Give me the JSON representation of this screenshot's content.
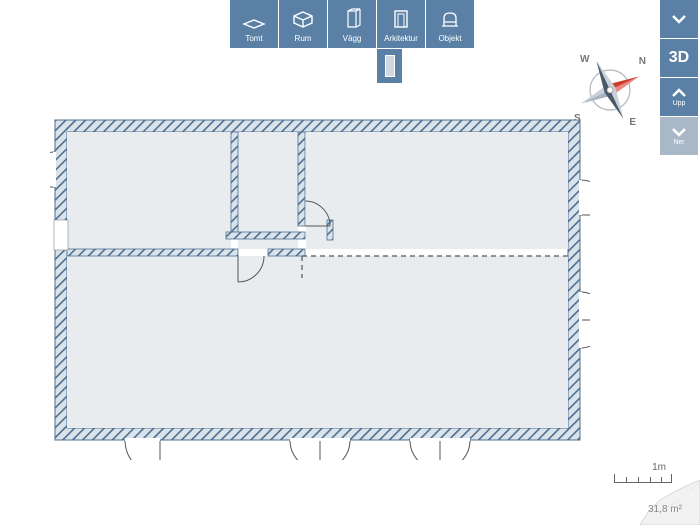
{
  "toolbar": {
    "items": [
      {
        "label": "Tomt"
      },
      {
        "label": "Rum"
      },
      {
        "label": "Vägg"
      },
      {
        "label": "Arkitektur"
      },
      {
        "label": "Objekt"
      }
    ]
  },
  "sidebar": {
    "view3d_label": "3D",
    "up_label": "Upp",
    "down_label": "Ner"
  },
  "compass": {
    "north": "N",
    "south": "S",
    "east": "E",
    "west": "W"
  },
  "scale": {
    "label": "1m"
  },
  "area": {
    "value": "31,8 m²"
  },
  "colors": {
    "primary": "#5a80a5",
    "wall_fill": "#dbe3ea",
    "wall_hatch": "#4d6f90",
    "room_fill": "#e9ecef",
    "compass_red": "#ce3a2a",
    "compass_dark": "#4a5968"
  }
}
